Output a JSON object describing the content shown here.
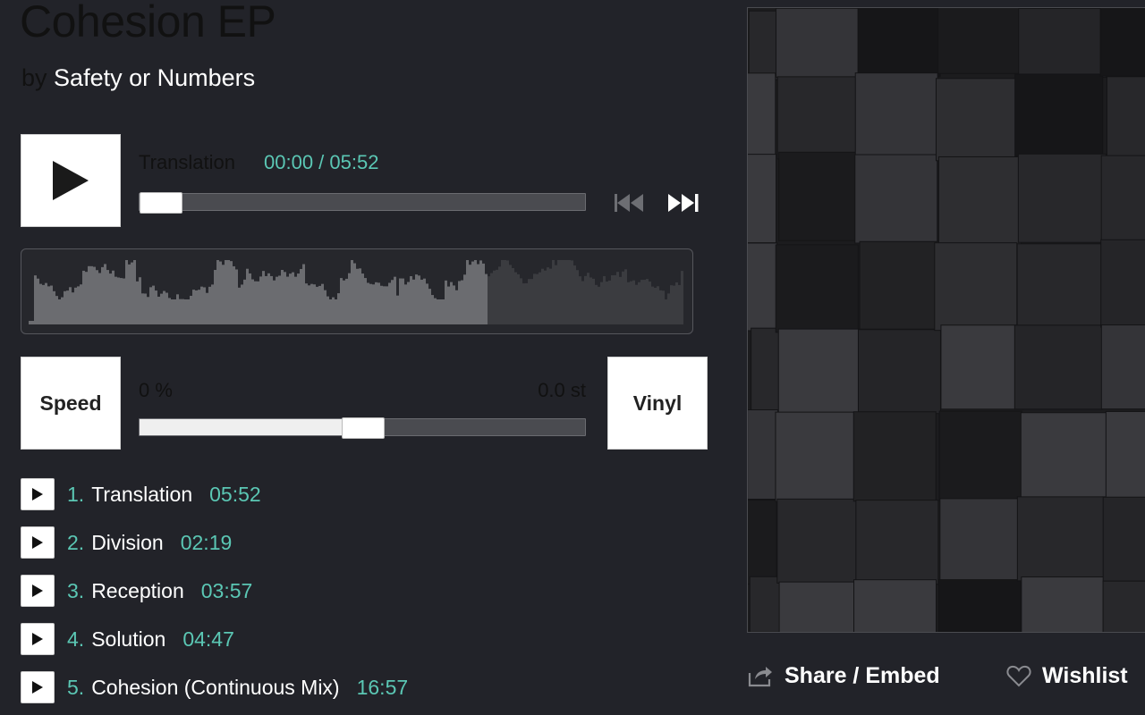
{
  "album": {
    "title": "Cohesion EP",
    "by_label": "by",
    "artist": "Safety or Numbers"
  },
  "player": {
    "now_playing_title": "Translation",
    "time_display": "00:00 / 05:52",
    "progress_fraction": 0.0,
    "waveform_played_fraction": 0.7,
    "controls": {
      "play_icon": "play-icon",
      "prev_icon": "skip-previous-icon",
      "next_icon": "skip-next-icon"
    }
  },
  "speed": {
    "button_label": "Speed",
    "speed_value": "0 %",
    "pitch_value": "0.0 st",
    "slider_fraction": 0.5,
    "vinyl_label": "Vinyl"
  },
  "tracks": [
    {
      "num": "1.",
      "name": "Translation",
      "duration": "05:52"
    },
    {
      "num": "2.",
      "name": "Division",
      "duration": "02:19"
    },
    {
      "num": "3.",
      "name": "Reception",
      "duration": "03:57"
    },
    {
      "num": "4.",
      "name": "Solution",
      "duration": "04:47"
    },
    {
      "num": "5.",
      "name": "Cohesion (Continuous Mix)",
      "duration": "16:57"
    }
  ],
  "actions": {
    "share_label": "Share / Embed",
    "share_icon": "share-icon",
    "wishlist_label": "Wishlist",
    "wishlist_icon": "heart-icon"
  },
  "colors": {
    "background": "#222329",
    "accent": "#5bc7b4",
    "text": "#ffffff",
    "dim_text": "#111111"
  }
}
